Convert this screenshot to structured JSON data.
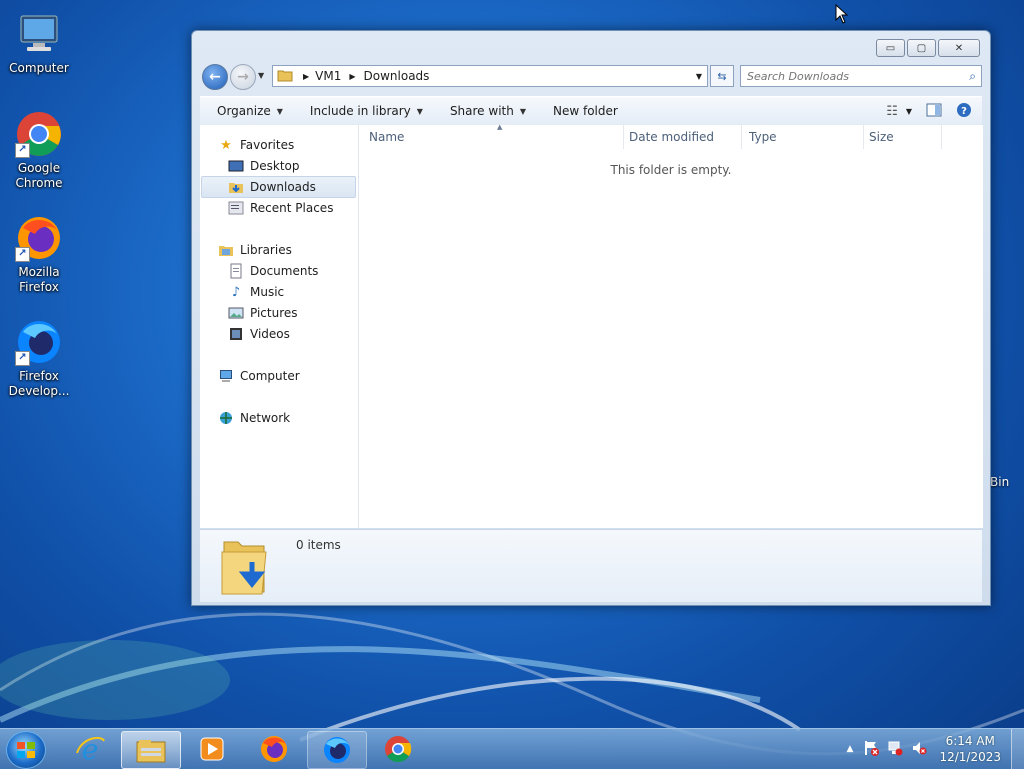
{
  "desktop": {
    "icons": [
      {
        "label": "Computer",
        "icon": "computer-icon"
      },
      {
        "label": "Google Chrome",
        "icon": "chrome-icon"
      },
      {
        "label": "Mozilla Firefox",
        "icon": "firefox-icon"
      },
      {
        "label": "Firefox Develop...",
        "icon": "firefox-developer-icon"
      }
    ],
    "recycle_partial": "Bin"
  },
  "window": {
    "buttons": {
      "minimize": "▭",
      "maximize": "▢",
      "close": "✕"
    },
    "breadcrumb": [
      "VM1",
      "Downloads"
    ],
    "search_placeholder": "Search Downloads",
    "toolbar": {
      "organize": "Organize",
      "include_in_library": "Include in library",
      "share_with": "Share with",
      "new_folder": "New folder"
    },
    "nav": {
      "favorites": {
        "label": "Favorites",
        "items": [
          "Desktop",
          "Downloads",
          "Recent Places"
        ]
      },
      "libraries": {
        "label": "Libraries",
        "items": [
          "Documents",
          "Music",
          "Pictures",
          "Videos"
        ]
      },
      "computer": "Computer",
      "network": "Network"
    },
    "selected_nav": "Downloads",
    "columns": [
      "Name",
      "Date modified",
      "Type",
      "Size"
    ],
    "empty_message": "This folder is empty.",
    "details_count": "0 items"
  },
  "taskbar": {
    "apps": [
      "start-orb",
      "internet-explorer",
      "windows-explorer",
      "media-player",
      "firefox",
      "firefox-developer",
      "chrome"
    ],
    "active_app": "windows-explorer",
    "time": "6:14 AM",
    "date": "12/1/2023",
    "tray_arrow": "▲"
  },
  "colors": {
    "accent": "#1c6cc9",
    "window_frame": "#cfdcec",
    "selection": "#dae6f3"
  }
}
